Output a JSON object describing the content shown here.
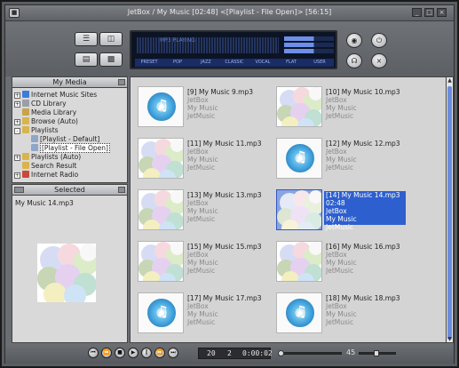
{
  "window": {
    "title": "JetBox / My Music [02:48]  <[Playlist - File Open]> [56:15]"
  },
  "display": {
    "freq_text": "MP3 PLAYING",
    "presets": [
      "PRESET",
      "POP",
      "JAZZ",
      "CLASSIC",
      "VOCAL",
      "FLAT",
      "USER"
    ]
  },
  "media_panel": {
    "title": "My Media",
    "items": [
      {
        "label": "Internet Music Sites",
        "expander": "+",
        "color": "#3b7dd8"
      },
      {
        "label": "CD Library",
        "expander": "+",
        "color": "#9aa0a8"
      },
      {
        "label": "Media Library",
        "expander": "",
        "color": "#c9a34a"
      },
      {
        "label": "Browse (Auto)",
        "expander": "+",
        "color": "#d8b44c"
      },
      {
        "label": "Playlists",
        "expander": "-",
        "color": "#d8b44c"
      },
      {
        "label": "[Playlist - Default]",
        "expander": "",
        "color": "#8fa6c8"
      },
      {
        "label": "[Playlist - File Open]",
        "expander": "",
        "color": "#8fa6c8"
      },
      {
        "label": "Playlists (Auto)",
        "expander": "+",
        "color": "#d8b44c"
      },
      {
        "label": "Search Result",
        "expander": "",
        "color": "#d8b44c"
      },
      {
        "label": "Internet Radio",
        "expander": "+",
        "color": "#c94a3a"
      }
    ]
  },
  "selected_panel": {
    "title": "Selected",
    "track_name": "My Music 14.mp3"
  },
  "tracks": [
    {
      "title": "[9] My Music 9.mp3",
      "duration": "",
      "artist": "JetBox",
      "album": "My Music",
      "genre": "JetMusic",
      "art": "disc"
    },
    {
      "title": "[10] My Music 10.mp3",
      "duration": "",
      "artist": "JetBox",
      "album": "My Music",
      "genre": "JetMusic",
      "art": "circles"
    },
    {
      "title": "[11] My Music 11.mp3",
      "duration": "",
      "artist": "JetBox",
      "album": "My Music",
      "genre": "JetMusic",
      "art": "circles"
    },
    {
      "title": "[12] My Music 12.mp3",
      "duration": "",
      "artist": "JetBox",
      "album": "My Music",
      "genre": "JetMusic",
      "art": "disc"
    },
    {
      "title": "[13] My Music 13.mp3",
      "duration": "",
      "artist": "JetBox",
      "album": "My Music",
      "genre": "JetMusic",
      "art": "circles"
    },
    {
      "title": "[14] My Music 14.mp3",
      "duration": "02:48",
      "artist": "JetBox",
      "album": "My Music",
      "genre": "JetMusic",
      "art": "circles",
      "active": true
    },
    {
      "title": "[15] My Music 15.mp3",
      "duration": "",
      "artist": "JetBox",
      "album": "My Music",
      "genre": "JetMusic",
      "art": "circles"
    },
    {
      "title": "[16] My Music 16.mp3",
      "duration": "",
      "artist": "JetBox",
      "album": "My Music",
      "genre": "JetMusic",
      "art": "circles"
    },
    {
      "title": "[17] My Music 17.mp3",
      "duration": "",
      "artist": "JetBox",
      "album": "My Music",
      "genre": "JetMusic",
      "art": "disc"
    },
    {
      "title": "[18] My Music 18.mp3",
      "duration": "",
      "artist": "JetBox",
      "album": "My Music",
      "genre": "JetMusic",
      "art": "disc"
    }
  ],
  "transport": {
    "buttons": [
      "prev-icon",
      "rewind-icon",
      "stop-icon",
      "play-icon",
      "pause-icon",
      "forward-icon",
      "next-icon"
    ],
    "track_count": "20",
    "track_number": "2",
    "elapsed": "0:00:02",
    "volume_label": "45",
    "seek_fraction": 0.0,
    "volume_fraction": 0.45
  },
  "colors": {
    "selection": "#2d5fcf",
    "frame": "#5a5d61"
  }
}
